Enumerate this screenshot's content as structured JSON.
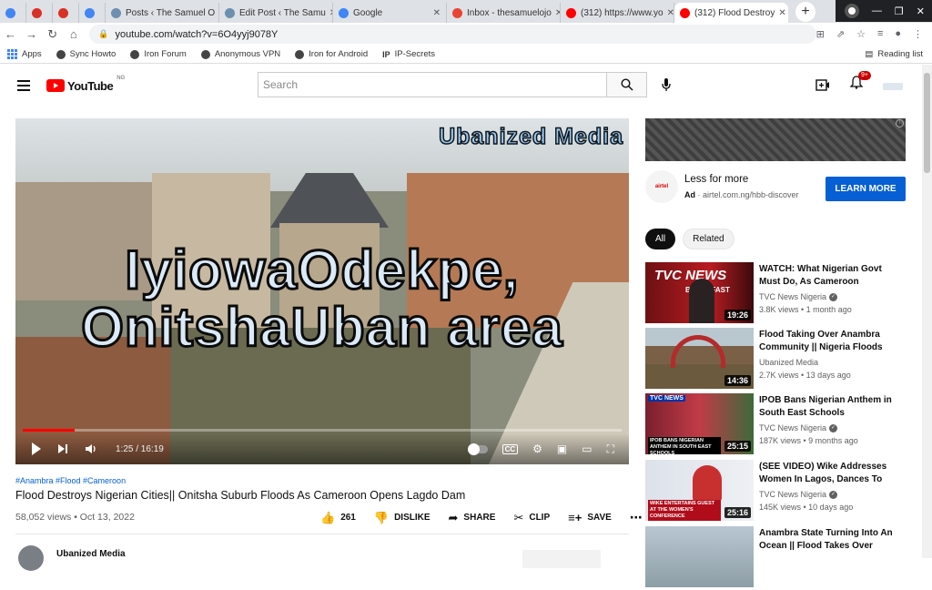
{
  "browser": {
    "tabs": [
      {
        "label": "",
        "fav": "#4285f4",
        "kind": "small"
      },
      {
        "label": "",
        "fav": "#d93025",
        "kind": "small"
      },
      {
        "label": "",
        "fav": "#d93025",
        "kind": "small"
      },
      {
        "label": "",
        "fav": "#4285f4",
        "kind": "small"
      },
      {
        "label": "Posts ‹ The Samuel O",
        "fav": "#6d8fb0",
        "kind": "wide"
      },
      {
        "label": "Edit Post ‹ The Samu",
        "fav": "#6d8fb0",
        "kind": "wide"
      },
      {
        "label": "Google",
        "fav": "#4285f4",
        "kind": "wide"
      },
      {
        "label": "Inbox - thesamuelojo",
        "fav": "#ea4335",
        "kind": "wide"
      },
      {
        "label": "(312) https://www.yo",
        "fav": "#ff0000",
        "kind": "wide"
      },
      {
        "label": "(312) Flood Destroy",
        "fav": "#ff0000",
        "kind": "wide",
        "active": true
      }
    ],
    "url": "youtube.com/watch?v=6O4yyj9078Y",
    "bookmarks": [
      "Apps",
      "Sync Howto",
      "Iron Forum",
      "Anonymous VPN",
      "Iron for Android",
      "IP-Secrets"
    ],
    "reading_list": "Reading list"
  },
  "youtube": {
    "logo_text": "YouTube",
    "country": "NG",
    "search_placeholder": "Search",
    "notification_count": "9+"
  },
  "video": {
    "overlay_brand": "Ubanized Media",
    "caption_line1": "IyiowaOdekpe,",
    "caption_line2": "OnitshaUban area",
    "time": "1:25 / 16:19",
    "progress_fraction": 0.087,
    "hashtags": "#Anambra #Flood #Cameroon",
    "title": "Flood Destroys Nigerian Cities|| Onitsha Suburb Floods As Cameroon Opens Lagdo Dam",
    "views": "58,052 views • Oct 13, 2022",
    "likes": "261",
    "dislike_label": "DISLIKE",
    "share_label": "SHARE",
    "clip_label": "CLIP",
    "save_label": "SAVE",
    "channel_name": "Ubanized Media"
  },
  "ad": {
    "title": "Less for more",
    "ad_label": "Ad",
    "url": "airtel.com.ng/hbb-discover",
    "cta": "LEARN MORE",
    "logo_text": "airtel"
  },
  "chips": [
    {
      "label": "All",
      "selected": true
    },
    {
      "label": "Related",
      "selected": false
    }
  ],
  "recommendations": [
    {
      "title": "WATCH: What Nigerian Govt Must Do, As Cameroon Opens...",
      "channel": "TVC News Nigeria",
      "verified": true,
      "meta": "3.8K views • 1 month ago",
      "duration": "19:26"
    },
    {
      "title": "Flood Taking Over Anambra Community || Nigeria Floods A...",
      "channel": "Ubanized Media",
      "verified": false,
      "meta": "2.7K views • 13 days ago",
      "duration": "14:36"
    },
    {
      "title": "IPOB Bans Nigerian Anthem in South East Schools",
      "channel": "TVC News Nigeria",
      "verified": true,
      "meta": "187K views • 9 months ago",
      "duration": "25:15"
    },
    {
      "title": "(SEE VIDEO) Wike Addresses Women In Lagos, Dances To \"...",
      "channel": "TVC News Nigeria",
      "verified": true,
      "meta": "145K views • 10 days ago",
      "duration": "25:16"
    },
    {
      "title": "Anambra State Turning Into An Ocean || Flood Takes Over Eigh...",
      "channel": "",
      "verified": false,
      "meta": "",
      "duration": ""
    }
  ],
  "thumb_texts": {
    "t0_brand": "TVC NEWS",
    "t0_sub": "BREAKFAST",
    "t2_brand": "TVC NEWS",
    "t2_banner": "IPOB BANS NIGERIAN ANTHEM IN SOUTH EAST SCHOOLS",
    "t3_banner": "WIKE ENTERTAINS GUEST AT THE WOMEN'S CONFERENCE"
  }
}
